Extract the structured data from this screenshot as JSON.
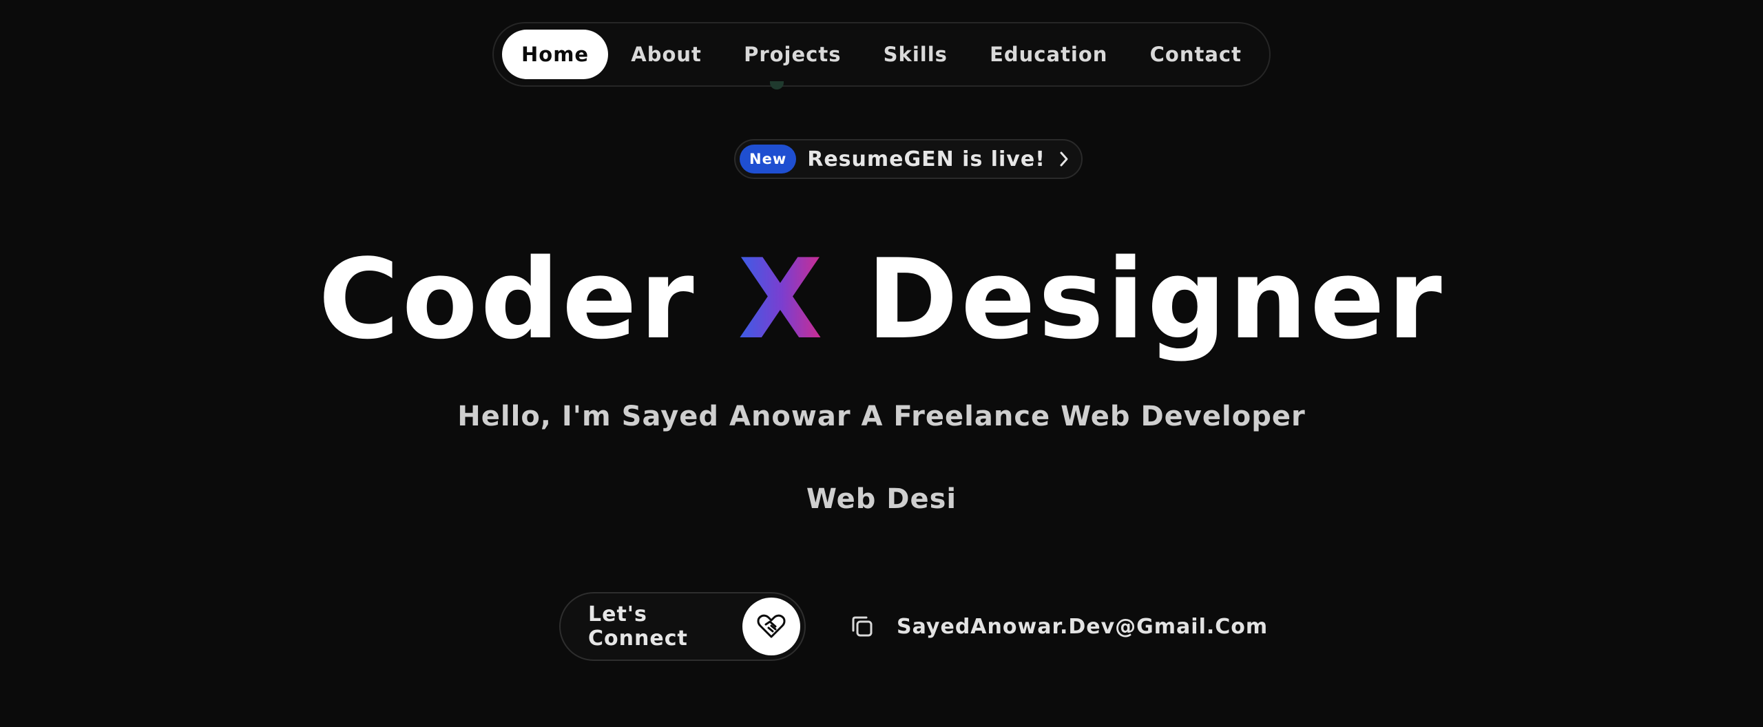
{
  "nav": {
    "items": [
      {
        "label": "Home",
        "active": true
      },
      {
        "label": "About",
        "active": false
      },
      {
        "label": "Projects",
        "active": false
      },
      {
        "label": "Skills",
        "active": false
      },
      {
        "label": "Education",
        "active": false
      },
      {
        "label": "Contact",
        "active": false
      }
    ]
  },
  "announcement": {
    "badge": "New",
    "text": "ResumeGEN is live!",
    "icon": "chevron-right-icon",
    "badge_color": "#1f4fd1"
  },
  "hero": {
    "title_part1": "Coder",
    "title_x": "X",
    "title_part2": "Designer",
    "gradient": [
      "#3b5ee6",
      "#7a3fd0",
      "#d42b8a"
    ],
    "subtitle": "Hello, I'm Sayed Anowar A Freelance Web Developer",
    "typed_text": "Web Desi"
  },
  "cta": {
    "connect_label": "Let's Connect",
    "connect_icon": "handshake-heart-icon",
    "email": "SayedAnowar.Dev@Gmail.Com",
    "copy_icon": "copy-icon"
  },
  "colors": {
    "background": "#0b0b0b",
    "text": "#ffffff",
    "muted_text": "#cfcfcf"
  }
}
